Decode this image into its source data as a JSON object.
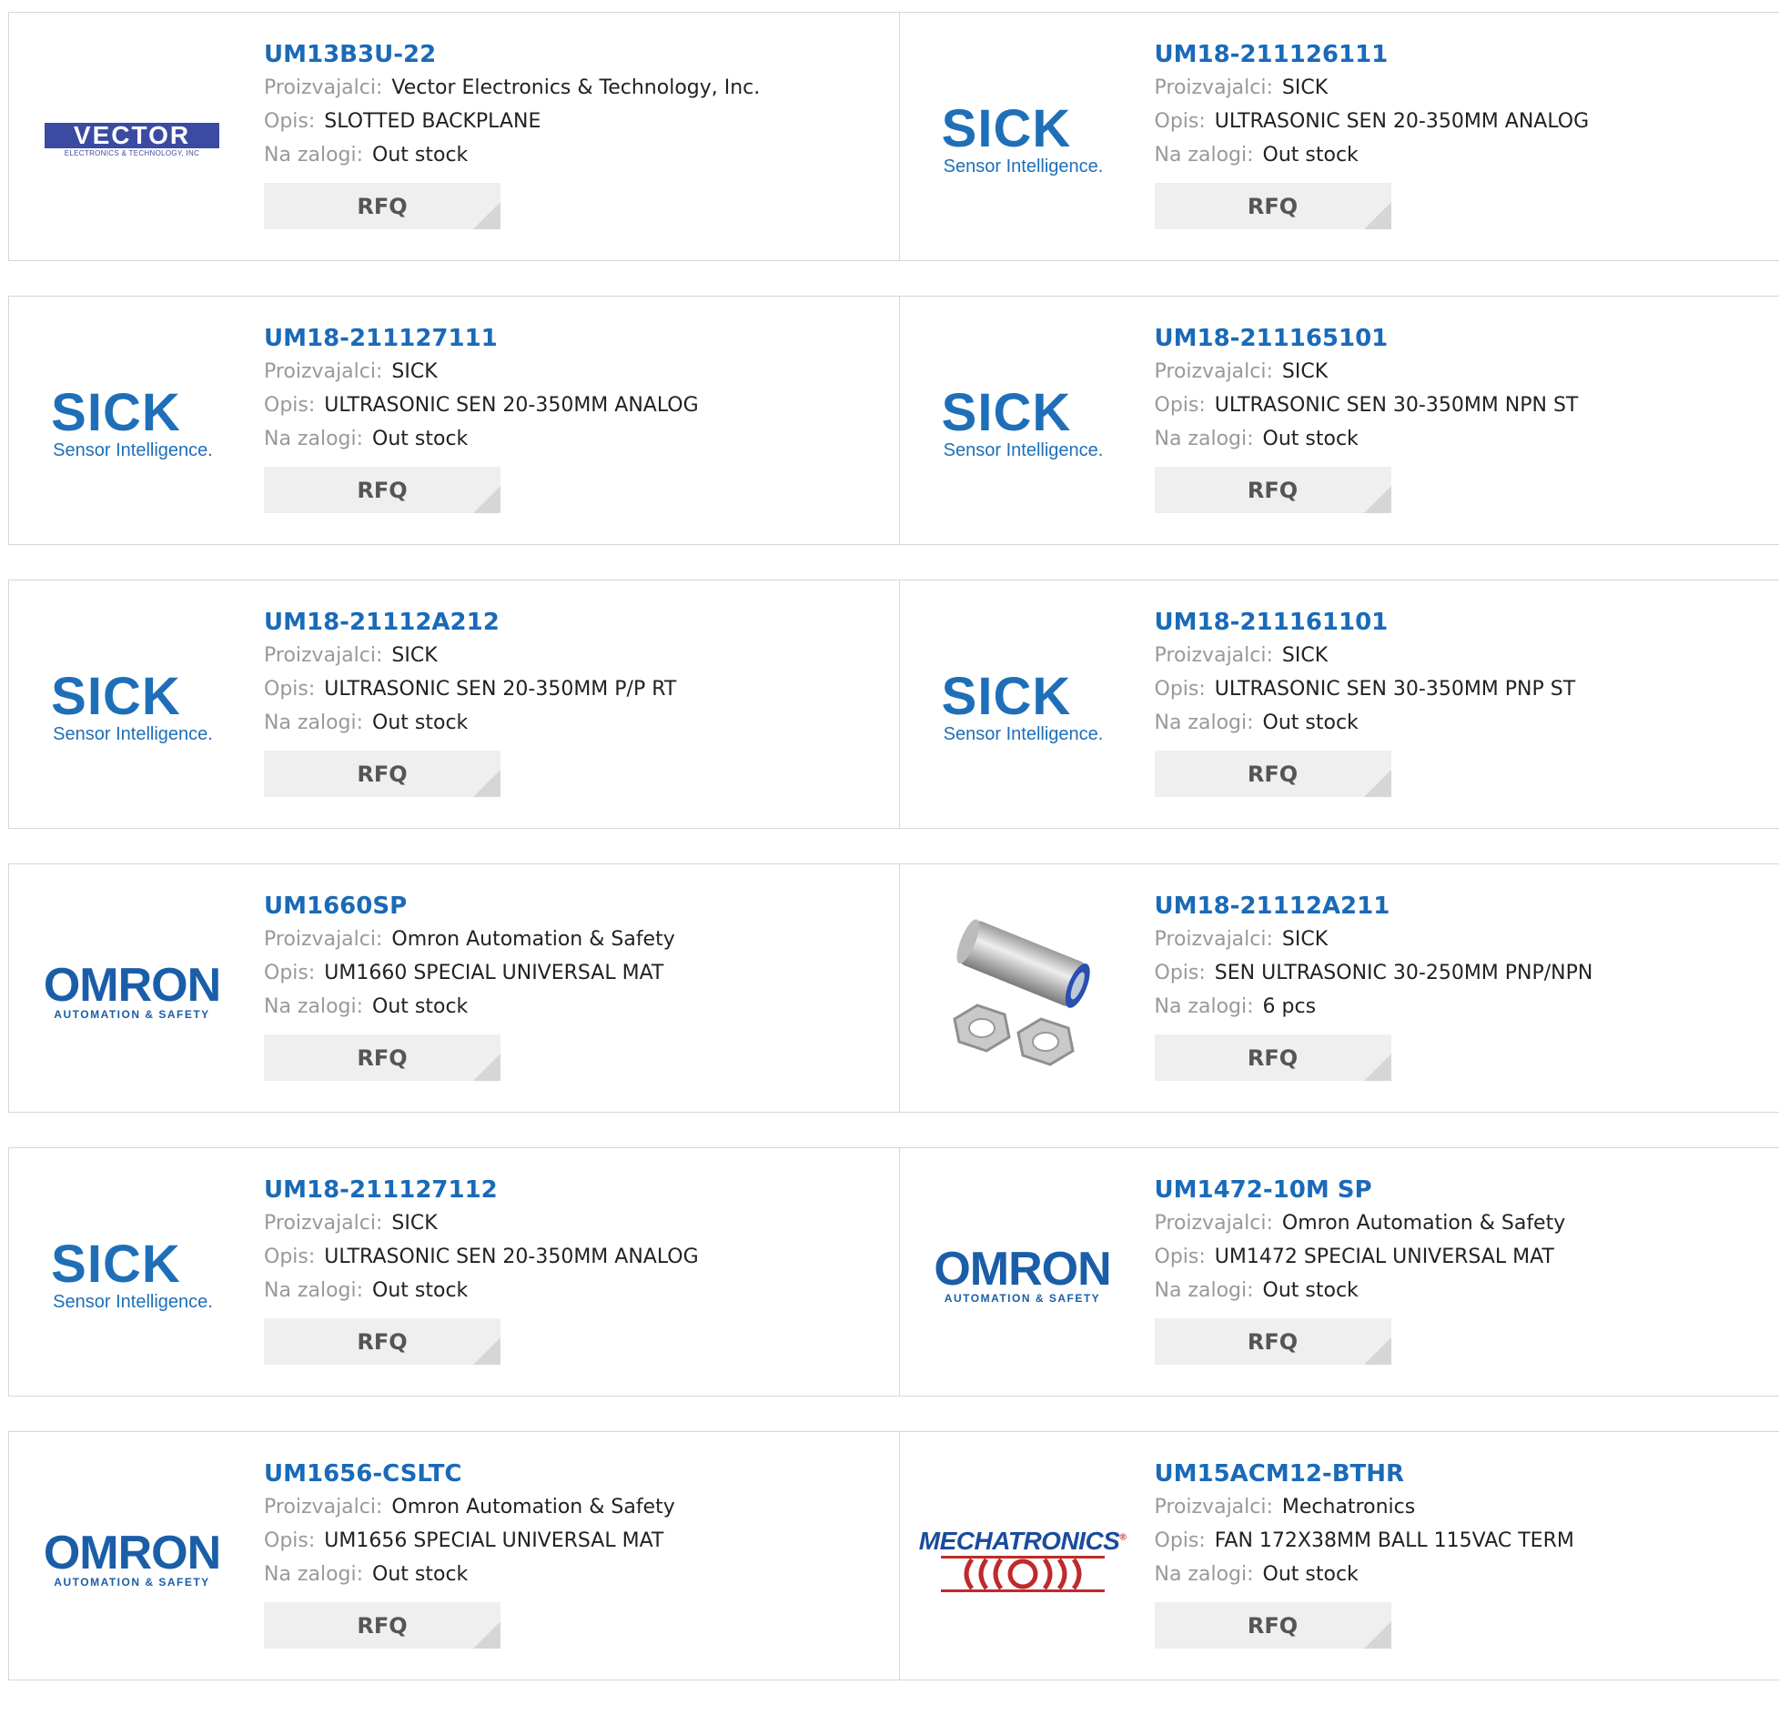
{
  "labels": {
    "manufacturer": "Proizvajalci:",
    "description": "Opis:",
    "stock": "Na zalogi:",
    "rfq": "RFQ"
  },
  "colors": {
    "title": "#1a6ab8",
    "label": "#999999",
    "value": "#222222",
    "rfq_bg": "#efefef",
    "border": "#d6d6d6"
  },
  "rows": [
    [
      {
        "part": "UM13B3U-22",
        "logo": "vector-logo",
        "logo_text": "VECTOR",
        "logo_sub": "ELECTRONICS & TECHNOLOGY, INC",
        "manufacturer": "Vector Electronics & Technology, Inc.",
        "description": "SLOTTED BACKPLANE",
        "stock": "Out stock"
      },
      {
        "part": "UM18-211126111",
        "logo": "sick-logo",
        "logo_text": "SICK",
        "logo_sub": "Sensor Intelligence.",
        "manufacturer": "SICK",
        "description": "ULTRASONIC SEN 20-350MM ANALOG",
        "stock": "Out stock"
      }
    ],
    [
      {
        "part": "UM18-211127111",
        "logo": "sick-logo",
        "logo_text": "SICK",
        "logo_sub": "Sensor Intelligence.",
        "manufacturer": "SICK",
        "description": "ULTRASONIC SEN 20-350MM ANALOG",
        "stock": "Out stock"
      },
      {
        "part": "UM18-211165101",
        "logo": "sick-logo",
        "logo_text": "SICK",
        "logo_sub": "Sensor Intelligence.",
        "manufacturer": "SICK",
        "description": "ULTRASONIC SEN 30-350MM NPN ST",
        "stock": "Out stock"
      }
    ],
    [
      {
        "part": "UM18-21112A212",
        "logo": "sick-logo",
        "logo_text": "SICK",
        "logo_sub": "Sensor Intelligence.",
        "manufacturer": "SICK",
        "description": "ULTRASONIC SEN 20-350MM P/P RT",
        "stock": "Out stock"
      },
      {
        "part": "UM18-211161101",
        "logo": "sick-logo",
        "logo_text": "SICK",
        "logo_sub": "Sensor Intelligence.",
        "manufacturer": "SICK",
        "description": "ULTRASONIC SEN 30-350MM PNP ST",
        "stock": "Out stock"
      }
    ],
    [
      {
        "part": "UM1660SP",
        "logo": "omron-logo",
        "logo_text": "OMRON",
        "logo_sub": "AUTOMATION & SAFETY",
        "manufacturer": "Omron Automation & Safety",
        "description": "UM1660 SPECIAL UNIVERSAL MAT",
        "stock": "Out stock"
      },
      {
        "part": "UM18-21112A211",
        "logo": "sensor-photo",
        "logo_text": "",
        "logo_sub": "",
        "manufacturer": "SICK",
        "description": "SEN ULTRASONIC 30-250MM PNP/NPN",
        "stock": "6 pcs"
      }
    ],
    [
      {
        "part": "UM18-211127112",
        "logo": "sick-logo",
        "logo_text": "SICK",
        "logo_sub": "Sensor Intelligence.",
        "manufacturer": "SICK",
        "description": "ULTRASONIC SEN 20-350MM ANALOG",
        "stock": "Out stock"
      },
      {
        "part": "UM1472-10M SP",
        "logo": "omron-logo",
        "logo_text": "OMRON",
        "logo_sub": "AUTOMATION & SAFETY",
        "manufacturer": "Omron Automation & Safety",
        "description": "UM1472 SPECIAL UNIVERSAL MAT",
        "stock": "Out stock"
      }
    ],
    [
      {
        "part": "UM1656-CSLTC",
        "logo": "omron-logo",
        "logo_text": "OMRON",
        "logo_sub": "AUTOMATION & SAFETY",
        "manufacturer": "Omron Automation & Safety",
        "description": "UM1656 SPECIAL UNIVERSAL MAT",
        "stock": "Out stock"
      },
      {
        "part": "UM15ACM12-BTHR",
        "logo": "mechatronics-logo",
        "logo_text": "MECHATRONICS",
        "logo_sub": "",
        "manufacturer": "Mechatronics",
        "description": "FAN 172X38MM BALL 115VAC TERM",
        "stock": "Out stock"
      }
    ]
  ]
}
